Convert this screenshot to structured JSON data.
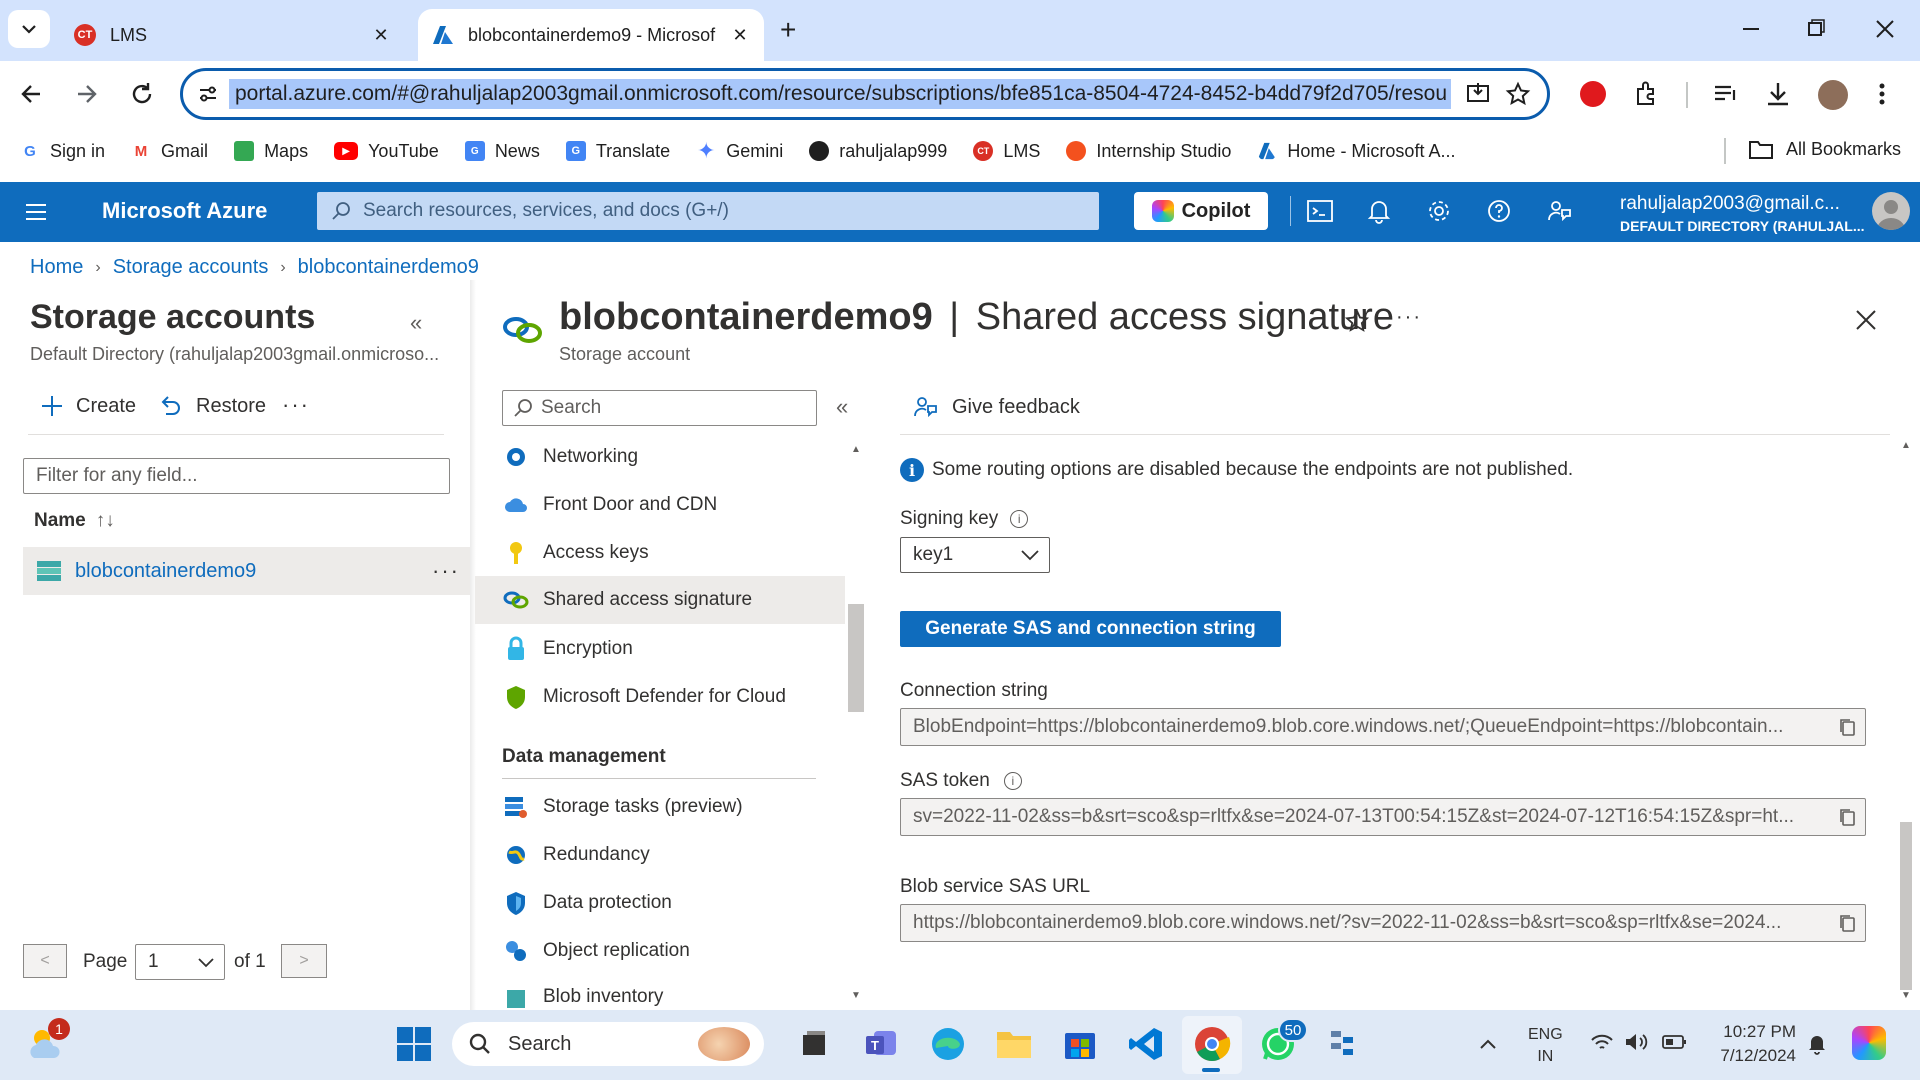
{
  "browser": {
    "tabs": [
      {
        "title": "LMS",
        "icon": "lms-icon",
        "active": false
      },
      {
        "title": "blobcontainerdemo9 - Microsof",
        "icon": "azure-icon",
        "active": true
      }
    ],
    "url": "portal.azure.com/#@rahuljalap2003gmail.onmicrosoft.com/resource/subscriptions/bfe851ca-8504-4724-8452-b4dd79f2d705/resou",
    "bookmarks": [
      {
        "label": "Sign in",
        "icon": "google-icon",
        "color": "#4285f4"
      },
      {
        "label": "Gmail",
        "icon": "gmail-icon",
        "color": "#ea4335"
      },
      {
        "label": "Maps",
        "icon": "maps-icon",
        "color": "#34a853"
      },
      {
        "label": "YouTube",
        "icon": "youtube-icon",
        "color": "#ff0000"
      },
      {
        "label": "News",
        "icon": "news-icon",
        "color": "#4285f4"
      },
      {
        "label": "Translate",
        "icon": "translate-icon",
        "color": "#4285f4"
      },
      {
        "label": "Gemini",
        "icon": "gemini-icon",
        "color": "#4e7fff"
      },
      {
        "label": "rahuljalap999",
        "icon": "github-icon",
        "color": "#1f1f1f"
      },
      {
        "label": "LMS",
        "icon": "lms-icon",
        "color": "#d93025"
      },
      {
        "label": "Internship Studio",
        "icon": "internship-icon",
        "color": "#f4511e"
      },
      {
        "label": "Home - Microsoft A...",
        "icon": "azure-icon",
        "color": "#0f6cbd"
      }
    ],
    "all_bookmarks": "All Bookmarks"
  },
  "azure": {
    "brand": "Microsoft Azure",
    "search_placeholder": "Search resources, services, and docs (G+/)",
    "copilot": "Copilot",
    "account_email": "rahuljalap2003@gmail.c...",
    "account_directory": "DEFAULT DIRECTORY (RAHULJAL...",
    "accent": "#0f6cbd"
  },
  "breadcrumb": [
    "Home",
    "Storage accounts",
    "blobcontainerdemo9"
  ],
  "left": {
    "title": "Storage accounts",
    "subtitle": "Default Directory (rahuljalap2003gmail.onmicroso...",
    "create": "Create",
    "restore": "Restore",
    "filter_placeholder": "Filter for any field...",
    "col_name": "Name",
    "item": "blobcontainerdemo9",
    "page_label": "Page",
    "page_value": "1",
    "page_of": "of 1"
  },
  "resource": {
    "name": "blobcontainerdemo9",
    "separator": "|",
    "blade": "Shared access signature",
    "type": "Storage account"
  },
  "menu": {
    "search_placeholder": "Search",
    "items": [
      {
        "label": "Networking",
        "icon": "networking-icon"
      },
      {
        "label": "Front Door and CDN",
        "icon": "cloud-icon"
      },
      {
        "label": "Access keys",
        "icon": "key-icon"
      },
      {
        "label": "Shared access signature",
        "icon": "link-icon"
      },
      {
        "label": "Encryption",
        "icon": "lock-icon"
      },
      {
        "label": "Microsoft Defender for Cloud",
        "icon": "shield-icon"
      }
    ],
    "section": "Data management",
    "items2": [
      {
        "label": "Storage tasks (preview)",
        "icon": "tasks-icon"
      },
      {
        "label": "Redundancy",
        "icon": "globe-icon"
      },
      {
        "label": "Data protection",
        "icon": "protection-icon"
      },
      {
        "label": "Object replication",
        "icon": "replication-icon"
      },
      {
        "label": "Blob inventory",
        "icon": "inventory-icon"
      }
    ]
  },
  "content": {
    "feedback": "Give feedback",
    "info": "Some routing options are disabled because the endpoints are not published.",
    "signing_key_label": "Signing key",
    "signing_key_value": "key1",
    "generate_button": "Generate SAS and connection string",
    "connection_label": "Connection string",
    "connection_value": "BlobEndpoint=https://blobcontainerdemo9.blob.core.windows.net/;QueueEndpoint=https://blobcontain...",
    "sas_label": "SAS token",
    "sas_value": "sv=2022-11-02&ss=b&srt=sco&sp=rltfx&se=2024-07-13T00:54:15Z&st=2024-07-12T16:54:15Z&spr=ht...",
    "bloburl_label": "Blob service SAS URL",
    "bloburl_value": "https://blobcontainerdemo9.blob.core.windows.net/?sv=2022-11-02&ss=b&srt=sco&sp=rltfx&se=2024..."
  },
  "taskbar": {
    "search": "Search",
    "weather_badge": "1",
    "whatsapp_badge": "50",
    "lang1": "ENG",
    "lang2": "IN",
    "time": "10:27 PM",
    "date": "7/12/2024"
  }
}
